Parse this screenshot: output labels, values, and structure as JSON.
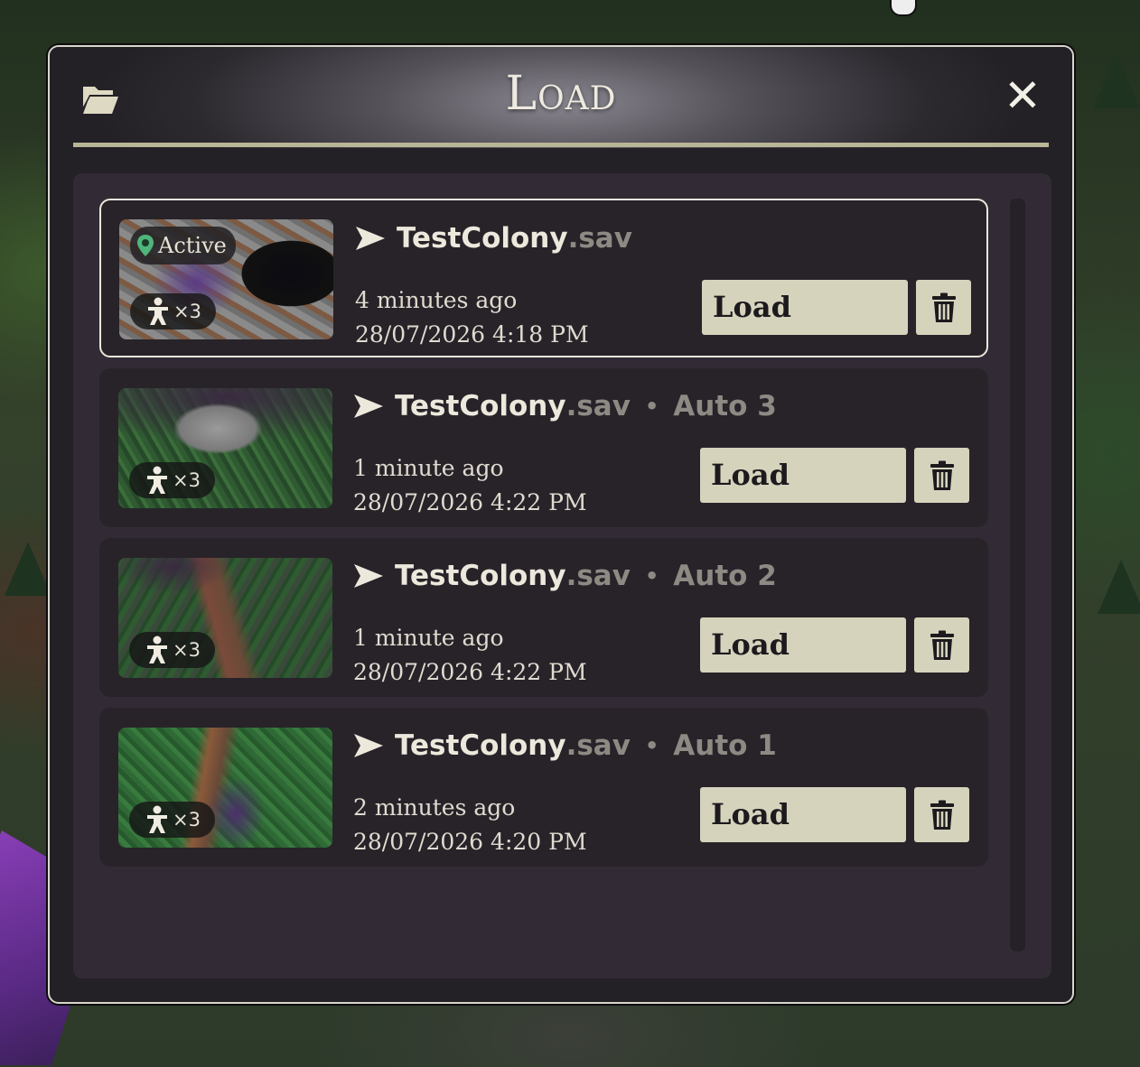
{
  "dialog": {
    "title": "Load",
    "folder_icon": "folder-open-icon",
    "close_icon": "close-icon",
    "close_glyph": "✕"
  },
  "saves": [
    {
      "active": true,
      "active_label": "Active",
      "colonists": "×3",
      "name": "TestColony",
      "ext": ".sav",
      "tag": "",
      "relative_time": "4 minutes ago",
      "timestamp": "28/07/2026 4:18 PM",
      "load_label": "Load"
    },
    {
      "active": false,
      "active_label": "",
      "colonists": "×3",
      "name": "TestColony",
      "ext": ".sav",
      "tag": "Auto 3",
      "relative_time": "1 minute ago",
      "timestamp": "28/07/2026 4:22 PM",
      "load_label": "Load"
    },
    {
      "active": false,
      "active_label": "",
      "colonists": "×3",
      "name": "TestColony",
      "ext": ".sav",
      "tag": "Auto 2",
      "relative_time": "1 minute ago",
      "timestamp": "28/07/2026 4:22 PM",
      "load_label": "Load"
    },
    {
      "active": false,
      "active_label": "",
      "colonists": "×3",
      "name": "TestColony",
      "ext": ".sav",
      "tag": "Auto 1",
      "relative_time": "2 minutes ago",
      "timestamp": "28/07/2026 4:20 PM",
      "load_label": "Load"
    }
  ],
  "separator": "•",
  "colors": {
    "accent": "#d6d3bd",
    "active_pin": "#4fb57a",
    "panel": "#322b35",
    "card": "#282329"
  }
}
